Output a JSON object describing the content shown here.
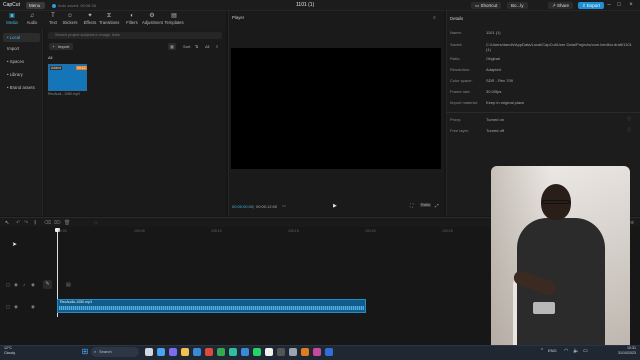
{
  "titlebar": {
    "logo": "CapCut",
    "menu": "Menu",
    "autosave": "Auto saved: 06:08:38",
    "project_name": "1101 (1)",
    "shortcut": "Shortcut",
    "user": "Bo...ly",
    "share": "Share",
    "export": "Export",
    "accent": "#1f8fd6"
  },
  "media_tabs": [
    {
      "label": "Media",
      "icon": "media-icon",
      "active": true
    },
    {
      "label": "Audio",
      "icon": "audio-icon"
    },
    {
      "label": "Text",
      "icon": "text-icon"
    },
    {
      "label": "Stickers",
      "icon": "stickers-icon"
    },
    {
      "label": "Effects",
      "icon": "effects-icon"
    },
    {
      "label": "Transitions",
      "icon": "transitions-icon"
    },
    {
      "label": "Filters",
      "icon": "filters-icon"
    },
    {
      "label": "Adjustment",
      "icon": "adjustment-icon"
    },
    {
      "label": "Templates",
      "icon": "templates-icon"
    }
  ],
  "sidebar": {
    "items": [
      {
        "label": "• Local",
        "active": true
      },
      {
        "label": "Import"
      },
      {
        "label": "• Spaces"
      },
      {
        "label": "• Library"
      },
      {
        "label": "• Brand assets"
      }
    ]
  },
  "media": {
    "search_placeholder": "Search project subjects in image, lines",
    "import": "Import",
    "sort": "Sort",
    "all_short": "All",
    "all_label": "All",
    "thumb_added": "Added",
    "thumb_duration": "00:12",
    "thumb_name": "RecAudi...1080.mp3"
  },
  "player": {
    "title": "Player",
    "time_current": "00:00:00:00",
    "time_total": "00:00:12:00",
    "ratio": "Ratio"
  },
  "details": {
    "title": "Details",
    "rows": [
      {
        "label": "Name:",
        "value": "1101 (1)"
      },
      {
        "label": "Saved:",
        "value": "C:/Users/dandh/AppData/Local/CapCut/User Data/Projects/com.lveditor.draft/1101 (1)"
      },
      {
        "label": "Ratio:",
        "value": "Original"
      },
      {
        "label": "Resolution:",
        "value": "Adapted"
      },
      {
        "label": "Color space:",
        "value": "SDR - Rec.709"
      },
      {
        "label": "Frame rate:",
        "value": "30.00fps"
      },
      {
        "label": "Import material:",
        "value": "Keep in original place"
      }
    ],
    "rows2": [
      {
        "label": "Proxy:",
        "value": "Turned on"
      },
      {
        "label": "Free layer:",
        "value": "Turned off"
      }
    ]
  },
  "timeline": {
    "ticks": [
      "00:00",
      "100:05",
      "100:10",
      "100:15",
      "100:20",
      "100:25"
    ],
    "audio_clip_name": "RecAudio-1080.mp3"
  },
  "taskbar": {
    "weather_temp": "12°C",
    "weather_desc": "Cloudy",
    "search": "Search",
    "time": "10:31",
    "date": "31/10/2023"
  }
}
